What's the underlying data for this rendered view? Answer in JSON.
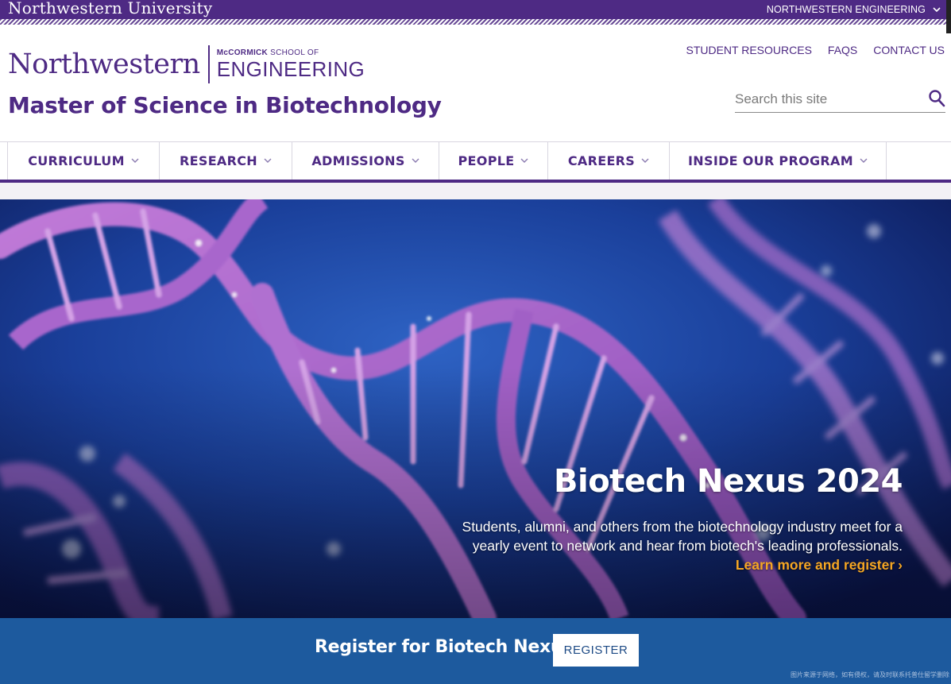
{
  "topbar": {
    "university": "Northwestern University",
    "engineering_link": "NORTHWESTERN ENGINEERING"
  },
  "header": {
    "logo_wordmark": "Northwestern",
    "logo_school_prefix_bold": "McCORMICK",
    "logo_school_prefix": " SCHOOL OF",
    "logo_school_name": "ENGINEERING",
    "site_title": "Master of Science in Biotechnology",
    "utility_links": [
      "STUDENT RESOURCES",
      "FAQS",
      "CONTACT US"
    ],
    "search": {
      "placeholder": "Search this site",
      "value": ""
    }
  },
  "nav": {
    "items": [
      {
        "label": "CURRICULUM"
      },
      {
        "label": "RESEARCH"
      },
      {
        "label": "ADMISSIONS"
      },
      {
        "label": "PEOPLE"
      },
      {
        "label": "CAREERS"
      },
      {
        "label": "INSIDE OUR PROGRAM"
      }
    ]
  },
  "hero": {
    "title": "Biotech Nexus 2024",
    "description": "Students, alumni, and others from the biotechnology industry meet for a yearly event to network and hear from biotech's leading professionals.",
    "link_label": "Learn more and register",
    "link_chevron": "›"
  },
  "register": {
    "text": "Register for Biotech Nexus",
    "button_label": "REGISTER"
  },
  "watermark": "图片来源于网络，如有侵权，请及时联系托普仕留学删除",
  "colors": {
    "brand_purple": "#4e2a84",
    "hero_link": "#f5a623",
    "register_band": "#1d5a9e"
  }
}
